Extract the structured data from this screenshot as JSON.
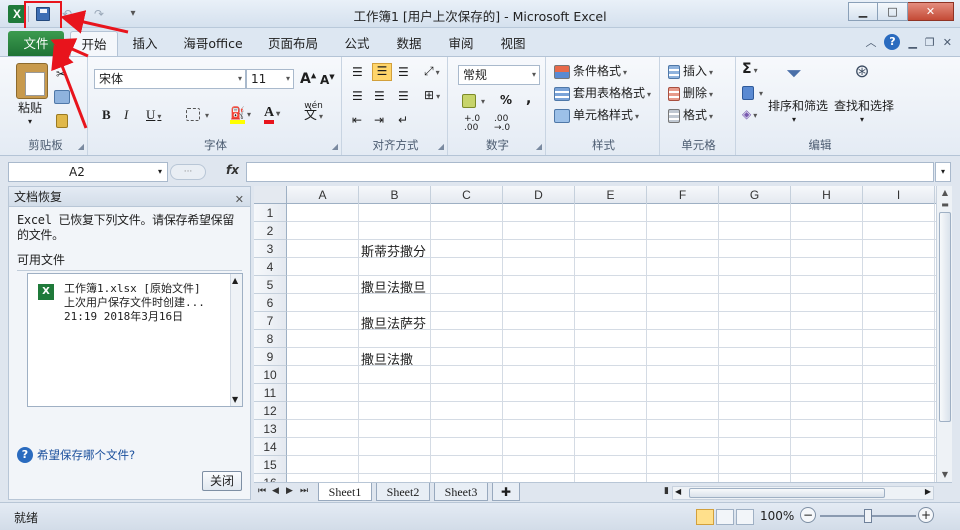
{
  "window": {
    "title": "工作簿1 [用户上次保存的] - Microsoft Excel",
    "app_icon": "X"
  },
  "ribbon_tabs": {
    "file": "文件",
    "tabs": [
      "开始",
      "插入",
      "海哥office",
      "页面布局",
      "公式",
      "数据",
      "审阅",
      "视图"
    ],
    "active": "开始"
  },
  "clipboard": {
    "paste": "粘贴",
    "label": "剪贴板"
  },
  "font": {
    "name": "宋体",
    "size": "11",
    "bold": "B",
    "italic": "I",
    "underline": "U",
    "grow": "A",
    "shrink": "A",
    "font_color": "A",
    "phonetic": "wén",
    "phonetic_char": "文",
    "label": "字体"
  },
  "alignment": {
    "label": "对齐方式"
  },
  "number": {
    "format": "常规",
    "percent": "%",
    "comma": ",",
    "inc_decimal": "+.0\n.00",
    "dec_decimal": ".00\n→.0",
    "label": "数字"
  },
  "styles": {
    "conditional": "条件格式",
    "table": "套用表格格式",
    "cell": "单元格样式",
    "label": "样式"
  },
  "cells": {
    "insert": "插入",
    "delete": "删除",
    "format": "格式",
    "label": "单元格"
  },
  "editing": {
    "sum": "Σ",
    "sort": "排序和筛选",
    "find": "查找和选择",
    "label": "编辑"
  },
  "formula_bar": {
    "name_box": "A2",
    "fx": "fx",
    "value": ""
  },
  "recovery": {
    "header": "文档恢复",
    "description": "Excel 已恢复下列文件。请保存希望保留的文件。",
    "available": "可用文件",
    "file_name": "工作簿1.xlsx  [原始文件]",
    "file_desc": "上次用户保存文件时创建...",
    "file_time": "21:19 2018年3月16日",
    "help": "希望保存哪个文件?",
    "close": "关闭"
  },
  "grid": {
    "columns": [
      "A",
      "B",
      "C",
      "D",
      "E",
      "F",
      "G",
      "H",
      "I"
    ],
    "rows": [
      "1",
      "2",
      "3",
      "4",
      "5",
      "6",
      "7",
      "8",
      "9",
      "10",
      "11",
      "12",
      "13",
      "14",
      "15",
      "16"
    ],
    "b2": "斯蒂芬撒分",
    "b4": "撒旦法撒旦",
    "b6": "撒旦法萨芬",
    "b8": "撒旦法撒"
  },
  "sheets": [
    "Sheet1",
    "Sheet2",
    "Sheet3"
  ],
  "status": {
    "text": "就绪",
    "zoom": "100%",
    "zoom_level": 1.0
  },
  "colors": {
    "accent_green": "#1f7335",
    "annotation_red": "#e8141c"
  }
}
